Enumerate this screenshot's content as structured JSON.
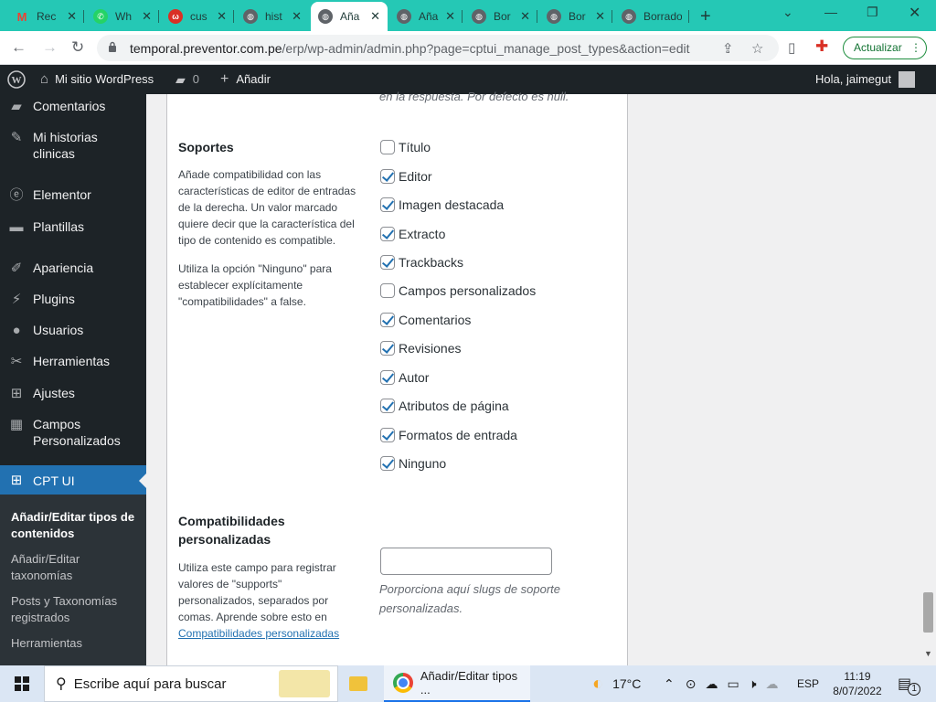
{
  "browser": {
    "tabs": [
      {
        "title": "Rec",
        "icon": "gmail-icon",
        "color": "#ea4335"
      },
      {
        "title": "Wh",
        "icon": "whatsapp-icon",
        "color": "#25d366"
      },
      {
        "title": "cus",
        "icon": "word-icon",
        "color": "#d93025"
      },
      {
        "title": "hist",
        "icon": "globe-icon",
        "color": "#5f6368"
      },
      {
        "title": "Aña",
        "icon": "globe-icon",
        "color": "#5f6368",
        "active": true
      },
      {
        "title": "Aña",
        "icon": "globe-icon",
        "color": "#5f6368"
      },
      {
        "title": "Bor",
        "icon": "globe-icon",
        "color": "#5f6368"
      },
      {
        "title": "Bor",
        "icon": "globe-icon",
        "color": "#5f6368"
      },
      {
        "title": "Borrado",
        "icon": "globe-icon",
        "color": "#5f6368"
      }
    ],
    "url_domain": "temporal.preventor.com.pe",
    "url_path": "/erp/wp-admin/admin.php?page=cptui_manage_post_types&action=edit",
    "update_label": "Actualizar"
  },
  "adminbar": {
    "site_name": "Mi sitio WordPress",
    "comments_count": "0",
    "add_label": "Añadir",
    "greeting": "Hola, jaimegut"
  },
  "sidebar": {
    "items": [
      {
        "label": "Comentarios",
        "icon": "comment-icon"
      },
      {
        "label": "Mi historias clinicas",
        "icon": "pin-icon"
      },
      {
        "label": "Elementor",
        "icon": "elementor-icon"
      },
      {
        "label": "Plantillas",
        "icon": "folder-icon"
      },
      {
        "label": "Apariencia",
        "icon": "brush-icon"
      },
      {
        "label": "Plugins",
        "icon": "plug-icon"
      },
      {
        "label": "Usuarios",
        "icon": "user-icon"
      },
      {
        "label": "Herramientas",
        "icon": "wrench-icon"
      },
      {
        "label": "Ajustes",
        "icon": "settings-icon"
      },
      {
        "label": "Campos Personalizados",
        "icon": "table-icon"
      },
      {
        "label": "CPT UI",
        "icon": "cptui-icon",
        "current": true
      }
    ],
    "submenu": [
      {
        "label": "Añadir/Editar tipos de contenidos",
        "current": true
      },
      {
        "label": "Añadir/Editar taxonomías"
      },
      {
        "label": "Posts y Taxonomías registrados"
      },
      {
        "label": "Herramientas"
      }
    ]
  },
  "main": {
    "prev_description": "en la respuesta. Por defecto es null.",
    "supports": {
      "title": "Soportes",
      "help1": "Añade compatibilidad con las características de editor de entradas de la derecha. Un valor marcado quiere decir que la característica del tipo de contenido es compatible.",
      "help2": "Utiliza la opción \"Ninguno\" para establecer explícitamente \"compatibilidades\" a false.",
      "options": [
        {
          "label": "Título",
          "checked": false
        },
        {
          "label": "Editor",
          "checked": true
        },
        {
          "label": "Imagen destacada",
          "checked": true
        },
        {
          "label": "Extracto",
          "checked": true
        },
        {
          "label": "Trackbacks",
          "checked": true
        },
        {
          "label": "Campos personalizados",
          "checked": false
        },
        {
          "label": "Comentarios",
          "checked": true
        },
        {
          "label": "Revisiones",
          "checked": true
        },
        {
          "label": "Autor",
          "checked": true
        },
        {
          "label": "Atributos de página",
          "checked": true
        },
        {
          "label": "Formatos de entrada",
          "checked": true
        },
        {
          "label": "Ninguno",
          "checked": true
        }
      ]
    },
    "custom_supports": {
      "title": "Compatibilidades personalizadas",
      "help_text": "Utiliza este campo para registrar valores de \"supports\" personalizados, separados por comas. Aprende sobre esto en",
      "help_link": "Compatibilidades personalizadas",
      "value": "",
      "description": "Porporciona aquí slugs de soporte personalizadas."
    }
  },
  "taskbar": {
    "search_placeholder": "Escribe aquí para buscar",
    "app_title": "Añadir/Editar tipos ...",
    "temperature": "17°C",
    "language": "ESP",
    "time": "11:19",
    "date": "8/07/2022",
    "notifications": "1"
  }
}
